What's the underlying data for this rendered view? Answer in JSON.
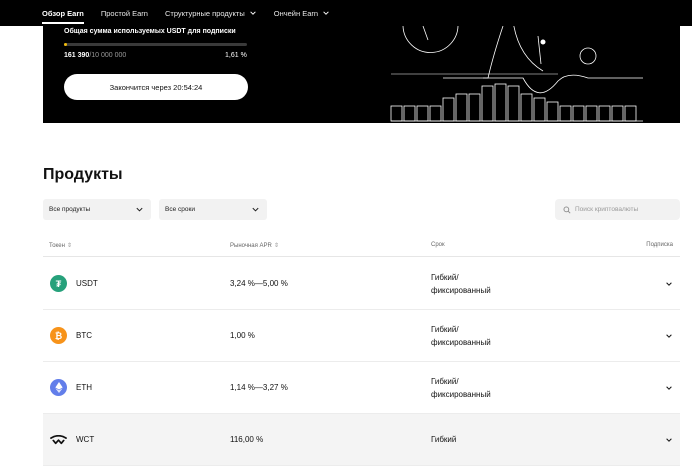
{
  "nav": {
    "items": [
      {
        "label": "Обзор Earn",
        "active": true,
        "dropdown": false
      },
      {
        "label": "Простой Earn",
        "active": false,
        "dropdown": false
      },
      {
        "label": "Структурные продукты",
        "active": false,
        "dropdown": true
      },
      {
        "label": "Ончейн Earn",
        "active": false,
        "dropdown": true
      }
    ]
  },
  "banner": {
    "label": "Общая сумма используемых USDT для подписки",
    "current": "161 390",
    "total": "/10 000 000",
    "percent": "1,61 %",
    "progress": 0.0161,
    "countdown": "Закончится через 20:54:24"
  },
  "products": {
    "title": "Продукты",
    "filter_products": "Все продукты",
    "filter_terms": "Все сроки",
    "search_placeholder": "Поиск криптовалюты",
    "columns": {
      "token": "Токен",
      "apr": "Рыночная APR",
      "term": "Срок",
      "subscribe": "Подписка"
    },
    "rows": [
      {
        "symbol": "USDT",
        "apr": "3,24 %—5,00 %",
        "term_line1": "Гибкий/",
        "term_line2": "фиксированный",
        "icon": "tether-icon",
        "color": "#26a17b"
      },
      {
        "symbol": "BTC",
        "apr": "1,00 %",
        "term_line1": "Гибкий/",
        "term_line2": "фиксированный",
        "icon": "bitcoin-icon",
        "color": "#f7931a"
      },
      {
        "symbol": "ETH",
        "apr": "1,14 %—3,27 %",
        "term_line1": "Гибкий/",
        "term_line2": "фиксированный",
        "icon": "ethereum-icon",
        "color": "#627eea"
      },
      {
        "symbol": "WCT",
        "apr": "116,00 %",
        "term_line1": "Гибкий",
        "term_line2": "",
        "icon": "walletconnect-icon",
        "color": "#111111"
      }
    ]
  }
}
